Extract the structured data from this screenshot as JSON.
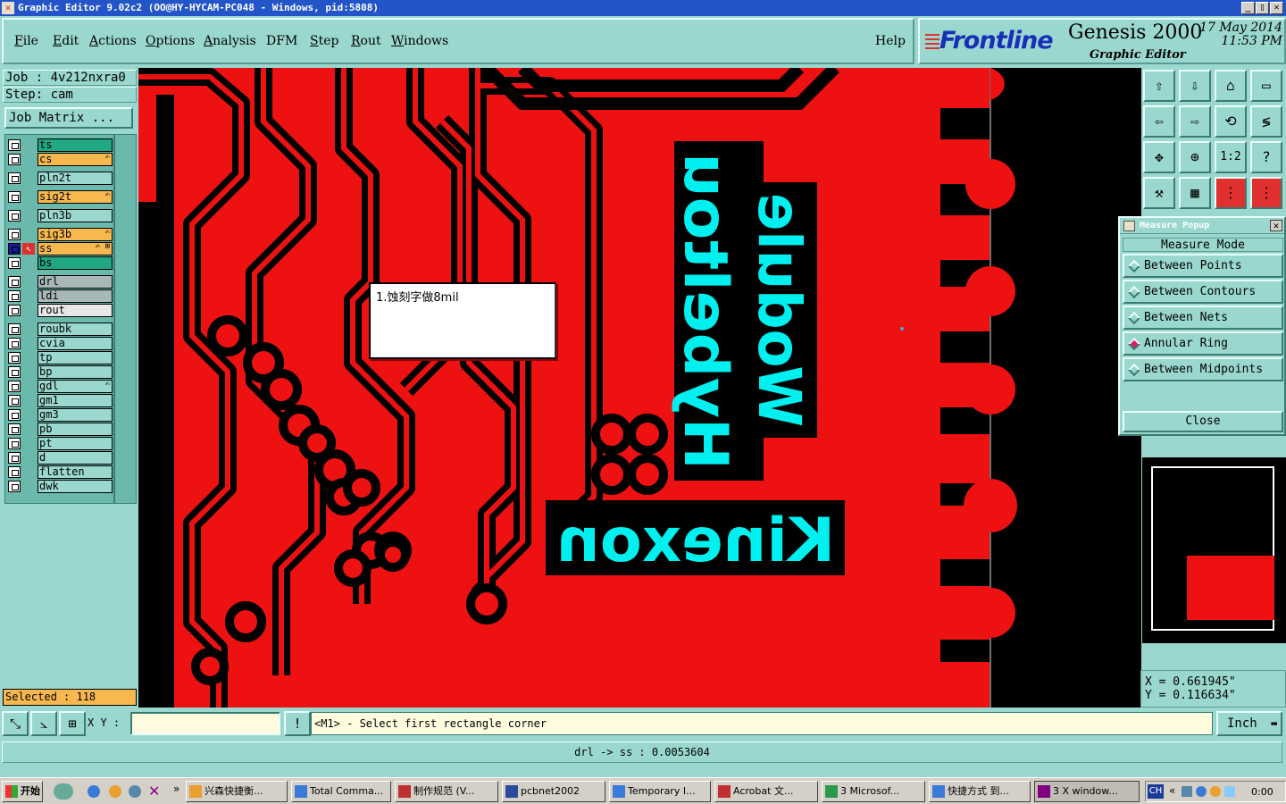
{
  "window": {
    "title": "Graphic Editor 9.02c2 (OO@HY-HYCAM-PC048 - Windows, pid:5808)",
    "min": "_",
    "max": "▯",
    "close": "✕"
  },
  "menu": {
    "items": [
      {
        "u": "F",
        "rest": "ile"
      },
      {
        "u": "E",
        "rest": "dit"
      },
      {
        "u": "A",
        "rest": "ctions"
      },
      {
        "u": "O",
        "rest": "ptions"
      },
      {
        "u": "A",
        "rest": "nalysis"
      },
      {
        "u": "",
        "rest": "DFM"
      },
      {
        "u": "S",
        "rest": "tep"
      },
      {
        "u": "R",
        "rest": "out"
      },
      {
        "u": "W",
        "rest": "indows"
      }
    ],
    "help": "Help"
  },
  "brand": {
    "logo": "Frontline",
    "product": "Genesis 2000",
    "subtitle": "Graphic Editor",
    "date": "17 May 2014",
    "time": "11:53 PM"
  },
  "job": {
    "job_line": "Job : 4v212nxra0",
    "step_line": "Step: cam",
    "matrix_button": "Job Matrix ..."
  },
  "layers": [
    {
      "name": "ts",
      "color": "#1fa882",
      "mark": ""
    },
    {
      "name": "cs",
      "color": "#f7b850",
      "mark": "✍"
    },
    {
      "name": "pln2t",
      "color": "#9ad8cf",
      "mark": ""
    },
    {
      "name": "sig2t",
      "color": "#f7b850",
      "mark": "✍"
    },
    {
      "name": "pln3b",
      "color": "#9ad8cf",
      "mark": ""
    },
    {
      "name": "sig3b",
      "color": "#f7b850",
      "mark": "✍"
    },
    {
      "name": "ss",
      "color": "#f7b850",
      "mark": "✍ ⊞"
    },
    {
      "name": "bs",
      "color": "#1fa882",
      "mark": ""
    },
    {
      "name": "drl",
      "color": "#a8b8b8",
      "mark": ""
    },
    {
      "name": "ldi",
      "color": "#a8b8b8",
      "mark": ""
    },
    {
      "name": "rout",
      "color": "#e8e8e8",
      "mark": ""
    },
    {
      "name": "roubk",
      "color": "#9ad8cf",
      "mark": ""
    },
    {
      "name": "cvia",
      "color": "#9ad8cf",
      "mark": ""
    },
    {
      "name": "tp",
      "color": "#9ad8cf",
      "mark": ""
    },
    {
      "name": "bp",
      "color": "#9ad8cf",
      "mark": ""
    },
    {
      "name": "gdl",
      "color": "#9ad8cf",
      "mark": "✍"
    },
    {
      "name": "gm1",
      "color": "#9ad8cf",
      "mark": ""
    },
    {
      "name": "gm3",
      "color": "#9ad8cf",
      "mark": ""
    },
    {
      "name": "pb",
      "color": "#9ad8cf",
      "mark": ""
    },
    {
      "name": "pt",
      "color": "#9ad8cf",
      "mark": ""
    },
    {
      "name": "d",
      "color": "#9ad8cf",
      "mark": ""
    },
    {
      "name": "flatten",
      "color": "#9ad8cf",
      "mark": ""
    },
    {
      "name": "dwk",
      "color": "#9ad8cf",
      "mark": ""
    }
  ],
  "selected": "Selected : 118",
  "canvas": {
    "note": "1.蚀刻字做8mil",
    "silk_text_1": "Wodule",
    "silk_text_2": "Hybeltou",
    "silk_text_3": "Kinexon"
  },
  "toolbar_icons": [
    "export-icon",
    "import-icon",
    "home-icon",
    "window-icon",
    "step-left-icon",
    "step-right-icon",
    "rotate-icon",
    "snake-icon",
    "fit-icon",
    "center-icon",
    "scale-icon",
    "help-icon",
    "tools-icon",
    "grid-icon",
    "layers-icon",
    "layers-red-icon"
  ],
  "toolbar_labels": {
    "scale": "1:2",
    "help": "?"
  },
  "measure": {
    "title": "Measure Popup",
    "mode_label": "Measure Mode",
    "options": [
      "Between Points",
      "Between Contours",
      "Between Nets",
      "Annular Ring",
      "Between Midpoints"
    ],
    "active": "Annular Ring",
    "close": "Close"
  },
  "coords": {
    "x": "X = 0.661945\"",
    "y": "Y = 0.116634\""
  },
  "command": {
    "xy_label": "X Y :",
    "input_value": "",
    "prompt": "<M1> - Select first rectangle corner",
    "units": "Inch",
    "excl": "!"
  },
  "status": "drl -> ss : 0.0053604",
  "taskbar": {
    "start": "开始",
    "tasks": [
      "兴森快捷衡...",
      "Total Comma...",
      "制作规范 (V...",
      "pcbnet2002",
      "Temporary I...",
      "Acrobat 文...",
      "3 Microsof...",
      "快捷方式 到...",
      "3 X window..."
    ],
    "lang": "CH",
    "clock": "0:00"
  },
  "colors": {
    "copper": "#ee1111",
    "silk": "#00f0f0",
    "panel": "#9ad8cf",
    "bg": "#000000"
  }
}
